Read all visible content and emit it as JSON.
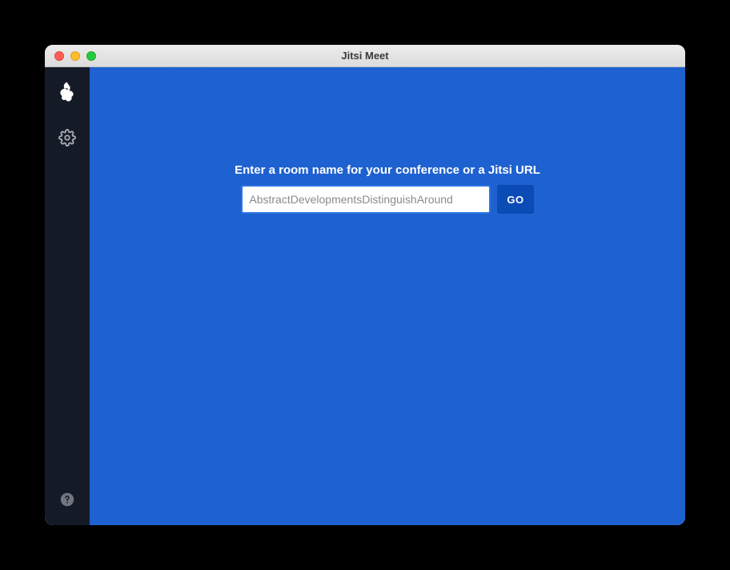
{
  "window": {
    "title": "Jitsi Meet"
  },
  "sidebar": {
    "items": [
      {
        "icon": "jitsi-logo"
      },
      {
        "icon": "settings"
      }
    ],
    "bottom": {
      "icon": "help"
    }
  },
  "main": {
    "prompt_label": "Enter a room name for your conference or a Jitsi URL",
    "room_input": {
      "value": "",
      "placeholder": "AbstractDevelopmentsDistinguishAround"
    },
    "go_button_label": "GO"
  }
}
